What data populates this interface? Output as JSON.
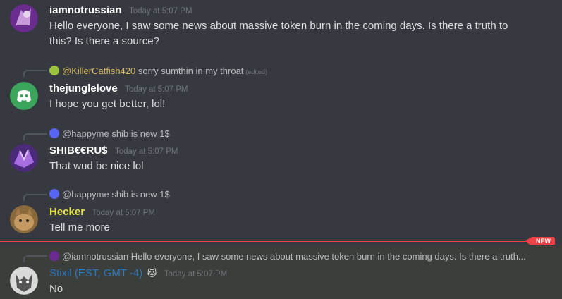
{
  "messages": [
    {
      "author": "iamnotrussian",
      "author_color": "#ffffff",
      "timestamp": "Today at 5:07 PM",
      "text": "Hello everyone, I saw some news about massive token burn in the coming days. Is there a truth to this? Is there a source?",
      "avatar": "purple-art-avatar"
    },
    {
      "reply_to": "@KillerCatfish420",
      "reply_color": "#d7b65e",
      "reply_text": "sorry sumthin in my throat",
      "reply_edited": "(edited)",
      "author": "thejunglelove",
      "author_color": "#ffffff",
      "timestamp": "Today at 5:07 PM",
      "text": "I hope you get better, lol!",
      "avatar": "discord-logo-avatar"
    },
    {
      "reply_to": "@happyme",
      "reply_text": "shib is new 1$",
      "author": "SHIB€€RU$",
      "author_color": "#ffffff",
      "timestamp": "Today at 5:07 PM",
      "text": "That wud be nice lol",
      "avatar": "purple-crystal-avatar"
    },
    {
      "reply_to": "@happyme",
      "reply_text": "shib is new 1$",
      "author": "Hecker",
      "author_color": "#e4e442",
      "timestamp": "Today at 5:07 PM",
      "text": "Tell me more",
      "avatar": "cat-avatar"
    },
    {
      "reply_to": "@iamnotrussian",
      "reply_text": "Hello everyone, I saw some news about massive token burn in the coming days. Is there a truth...",
      "author": "Stixil (EST, GMT -4)",
      "author_color": "#2a7ac0",
      "author_badge": "🐱",
      "timestamp": "Today at 5:07 PM",
      "text": "No",
      "avatar": "wolf-avatar"
    }
  ],
  "new_badge": "NEW"
}
